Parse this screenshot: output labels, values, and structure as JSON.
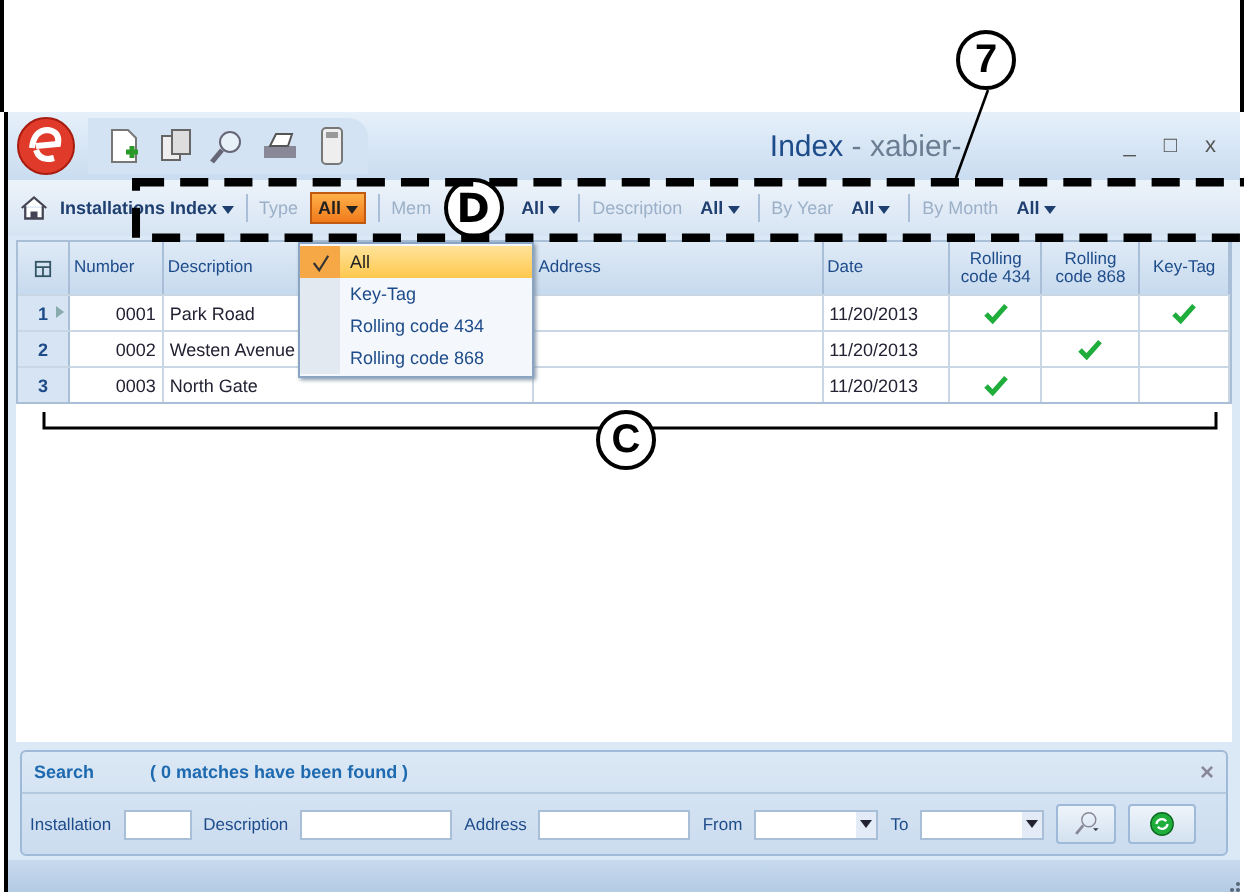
{
  "window": {
    "title": "Index",
    "subtitle": "- xabier-",
    "controls": [
      "_",
      "□",
      "x"
    ]
  },
  "filter_bar": {
    "index_label": "Installations Index",
    "filters": [
      {
        "label": "Type",
        "value": "All",
        "active": true
      },
      {
        "label": "Mem",
        "value": "All",
        "active": false
      },
      {
        "label": "Description",
        "value": "All",
        "active": false
      },
      {
        "label": "By Year",
        "value": "All",
        "active": false
      },
      {
        "label": "By Month",
        "value": "All",
        "active": false
      }
    ]
  },
  "type_menu": {
    "items": [
      {
        "label": "All",
        "selected": true
      },
      {
        "label": "Key-Tag",
        "selected": false
      },
      {
        "label": "Rolling code 434",
        "selected": false
      },
      {
        "label": "Rolling code 868",
        "selected": false
      }
    ]
  },
  "table": {
    "columns": [
      "Number",
      "Description",
      "Address",
      "Date",
      "Rolling code 434",
      "Rolling code 868",
      "Key-Tag"
    ],
    "rows": [
      {
        "row": "1",
        "current": true,
        "number": "0001",
        "description": "Park Road",
        "date": "11/20/2013",
        "rolling_434": true,
        "rolling_868": false,
        "key_tag": true
      },
      {
        "row": "2",
        "current": false,
        "number": "0002",
        "description": "Westen Avenue",
        "date": "11/20/2013",
        "rolling_434": false,
        "rolling_868": true,
        "key_tag": false
      },
      {
        "row": "3",
        "current": false,
        "number": "0003",
        "description": "North Gate",
        "date": "11/20/2013",
        "rolling_434": true,
        "rolling_868": false,
        "key_tag": false
      }
    ]
  },
  "search_panel": {
    "title": "Search",
    "status": "( 0 matches have been found )",
    "close": "×",
    "fields": [
      {
        "label": "Installation",
        "kind": "text"
      },
      {
        "label": "Description",
        "kind": "text"
      },
      {
        "label": "Address",
        "kind": "text"
      },
      {
        "label": "From",
        "kind": "date"
      },
      {
        "label": "To",
        "kind": "date"
      }
    ]
  },
  "callouts": [
    {
      "label": "7",
      "kind": "pointer"
    },
    {
      "label": "D",
      "kind": "box"
    },
    {
      "label": "C",
      "kind": "bracket"
    }
  ]
}
